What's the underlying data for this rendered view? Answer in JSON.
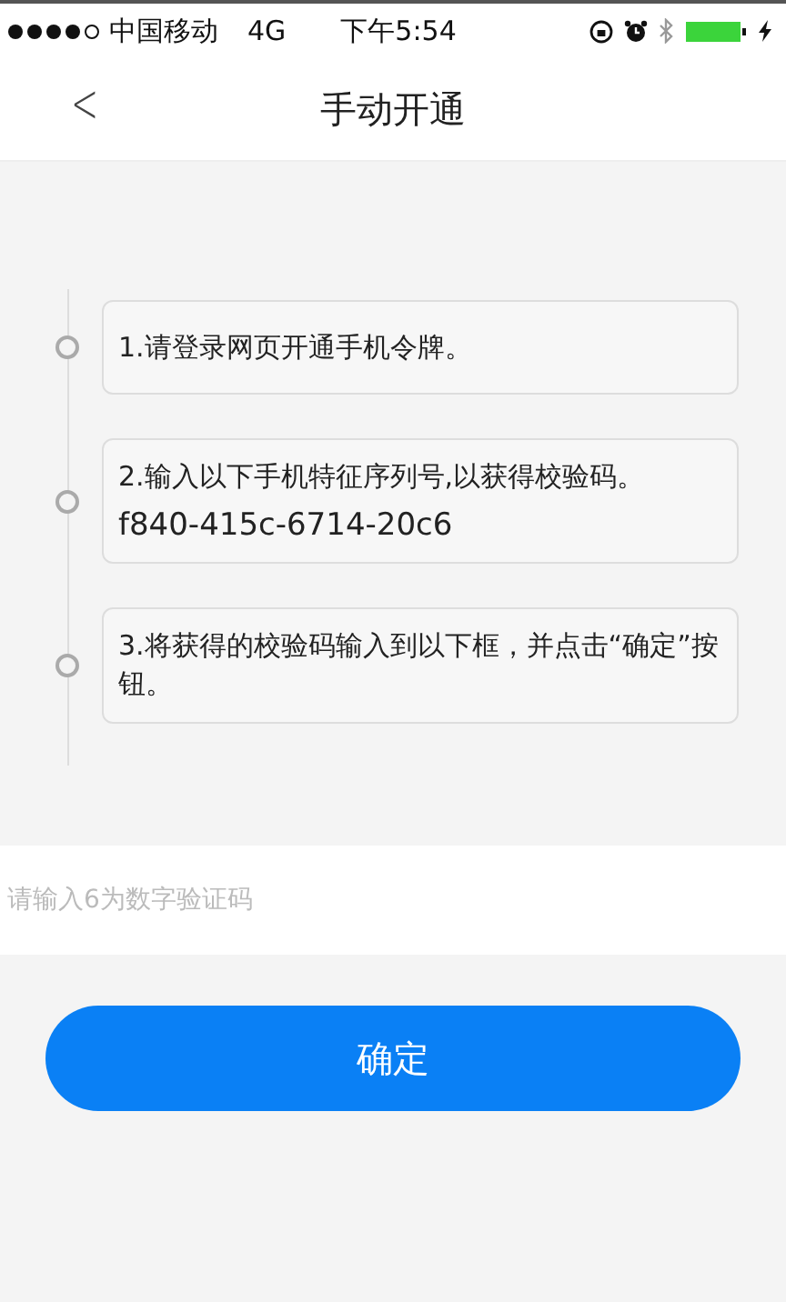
{
  "status_bar": {
    "carrier": "中国移动",
    "network": "4G",
    "time": "下午5:54"
  },
  "nav": {
    "back": "<",
    "title": "手动开通"
  },
  "steps": [
    {
      "text": "1.请登录网页开通手机令牌。"
    },
    {
      "text": "2.输入以下手机特征序列号,以获得校验码。",
      "code": "f840-415c-6714-20c6"
    },
    {
      "text": "3.将获得的校验码输入到以下框，并点击“确定”按钮。"
    }
  ],
  "code_field": {
    "placeholder": "请输入6为数字验证码"
  },
  "confirm_button": "确定"
}
